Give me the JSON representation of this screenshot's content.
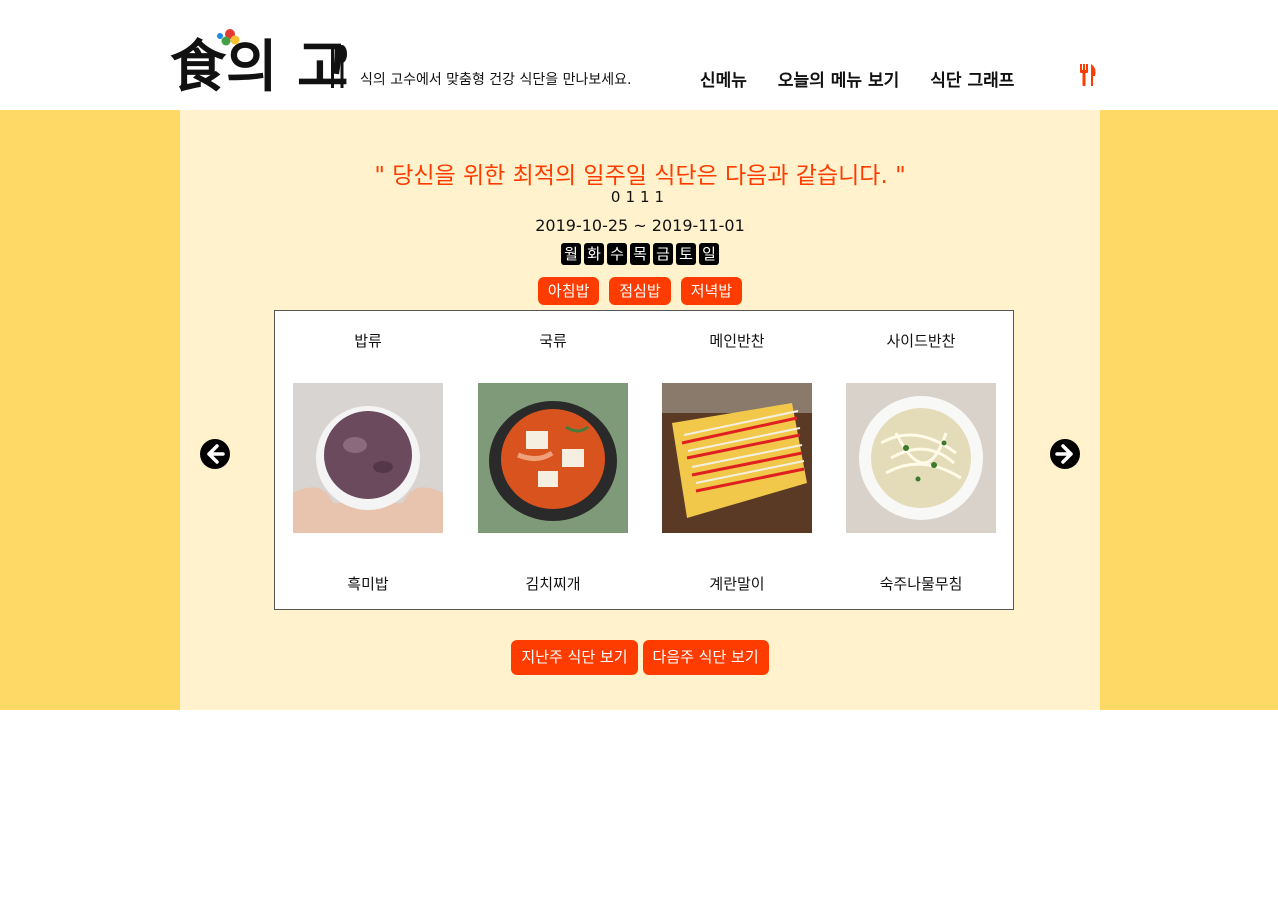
{
  "header": {
    "logo_text": "食의 고수",
    "tagline": "식의 고수에서 맞춤형 건강 식단을 만나보세요.",
    "nav": [
      "신메뉴",
      "오늘의 메뉴 보기",
      "식단 그래프"
    ],
    "cutlery_icon": "fork-knife-icon"
  },
  "colors": {
    "accent": "#ff3c00",
    "band": "#ffd966",
    "panel": "#fff2cc"
  },
  "main": {
    "headline": "\" 당신을 위한 최적의 일주일 식단은 다음과 같습니다. \"",
    "code": "0111",
    "date_range": "2019-10-25 ~ 2019-11-01",
    "days": [
      "월",
      "화",
      "수",
      "목",
      "금",
      "토",
      "일"
    ],
    "meals": [
      "아침밥",
      "점심밥",
      "저녁밥"
    ],
    "categories": [
      "밥류",
      "국류",
      "메인반찬",
      "사이드반찬"
    ],
    "dishes": [
      "흑미밥",
      "김치찌개",
      "계란말이",
      "숙주나물무침"
    ],
    "prev_week": "지난주 식단 보기",
    "next_week": "다음주 식단 보기",
    "prev_icon": "arrow-left-circle-icon",
    "next_icon": "arrow-right-circle-icon"
  }
}
